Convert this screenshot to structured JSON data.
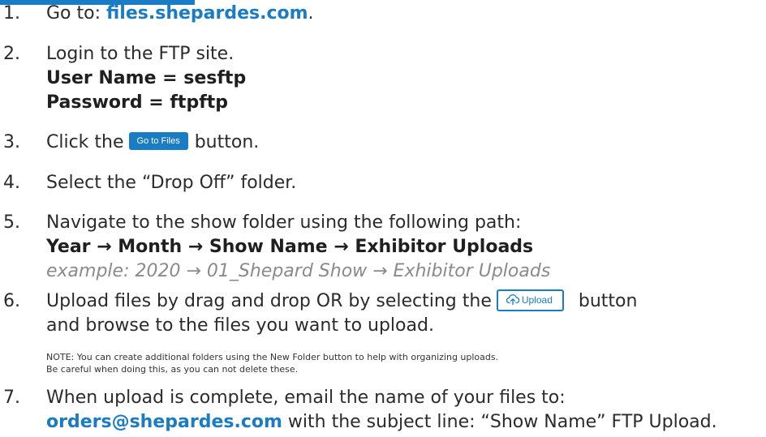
{
  "steps": [
    {
      "num": "1.",
      "text_before": "Go to: ",
      "link": "files.shepardes.com",
      "text_after": "."
    },
    {
      "num": "2.",
      "text": "Login to the FTP site.",
      "username_line": "User Name = sesftp",
      "password_line": "Password = ftpftp"
    },
    {
      "num": "3.",
      "text_before": "Click the",
      "button_label": "Go to Files",
      "text_after": "button."
    },
    {
      "num": "4.",
      "text": "Select the “Drop Off” folder."
    },
    {
      "num": "5.",
      "text": "Navigate to the show folder using the following path:",
      "path": "Year → Month → Show Name → Exhibitor Uploads",
      "example": "example: 2020 → 01_Shepard Show → Exhibitor Uploads"
    },
    {
      "num": "6.",
      "text_before": "Upload files by drag and drop OR by selecting the",
      "button_label": "Upload",
      "text_after": "button",
      "line2": "and browse to the files you want to upload.",
      "note_line1": "NOTE: You can create additional folders using the New Folder button to help with organizing uploads.",
      "note_line2": "Be careful when doing this, as you can not delete these."
    },
    {
      "num": "7.",
      "text": "When upload is complete, email the name of your files to:",
      "email": "orders@shepardes.com",
      "text_after": " with the subject line: “Show Name” FTP Upload."
    }
  ],
  "colors": {
    "accent": "#1a7cc4",
    "text": "#2b2b2b",
    "example_gray": "#8a8a8a"
  },
  "icons": {
    "upload": "cloud-upload-icon"
  }
}
